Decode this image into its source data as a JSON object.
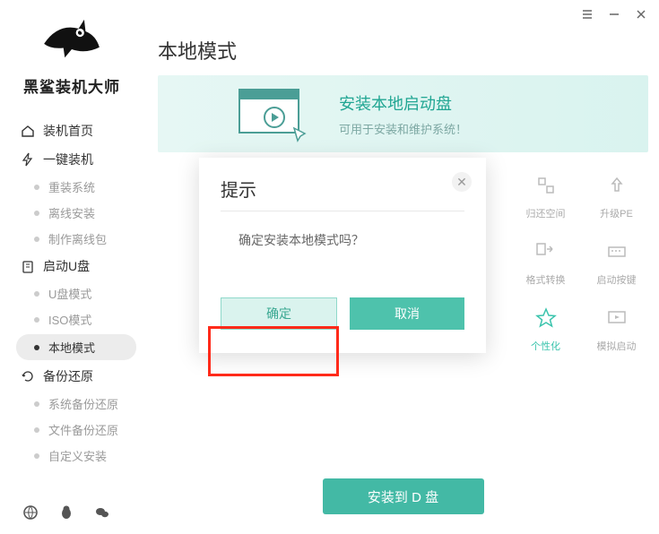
{
  "app": {
    "title": "黑鲨装机大师"
  },
  "nav": {
    "groups": [
      {
        "label": "装机首页",
        "children": []
      },
      {
        "label": "一键装机",
        "children": [
          "重装系统",
          "离线安装",
          "制作离线包"
        ]
      },
      {
        "label": "启动U盘",
        "children": [
          "U盘模式",
          "ISO模式",
          "本地模式"
        ]
      },
      {
        "label": "备份还原",
        "children": [
          "系统备份还原",
          "文件备份还原",
          "自定义安装"
        ]
      }
    ],
    "active": "本地模式"
  },
  "page": {
    "title": "本地模式"
  },
  "banner": {
    "title": "安装本地启动盘",
    "subtitle": "可用于安装和维护系统！"
  },
  "tools": [
    {
      "label": "归还空间"
    },
    {
      "label": "升级PE"
    },
    {
      "label": "格式转换"
    },
    {
      "label": "启动按键"
    },
    {
      "label": "个性化",
      "active": true
    },
    {
      "label": "模拟启动"
    }
  ],
  "install_button": "安装到 D 盘",
  "dialog": {
    "title": "提示",
    "message": "确定安装本地模式吗？",
    "ok": "确定",
    "cancel": "取消"
  }
}
